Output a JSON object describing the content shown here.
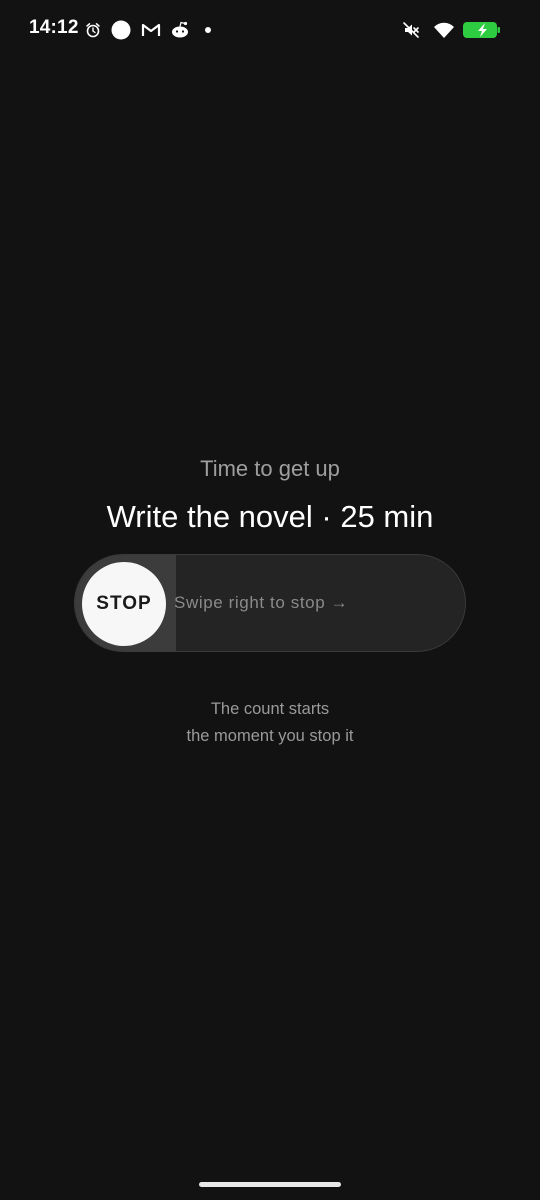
{
  "status_bar": {
    "time": "14:12",
    "left_icons": [
      "alarm-icon",
      "circle-icon",
      "gmail-icon",
      "reddit-icon",
      "dot-icon"
    ],
    "right_icons": [
      "mute-icon",
      "wifi-icon",
      "battery-charging-icon"
    ],
    "battery_color": "#2ecc40"
  },
  "main": {
    "subtitle": "Time to get up",
    "task_title": "Write the novel · 25 min",
    "slider": {
      "knob_label": "STOP",
      "hint": "Swipe right to stop →",
      "progress": 0.26
    },
    "caption_line1": "The count starts",
    "caption_line2": "the moment you stop it"
  },
  "colors": {
    "background": "#121212",
    "slider_track": "#242424",
    "slider_fill": "#3c3c3c",
    "knob": "#f7f7f7"
  }
}
